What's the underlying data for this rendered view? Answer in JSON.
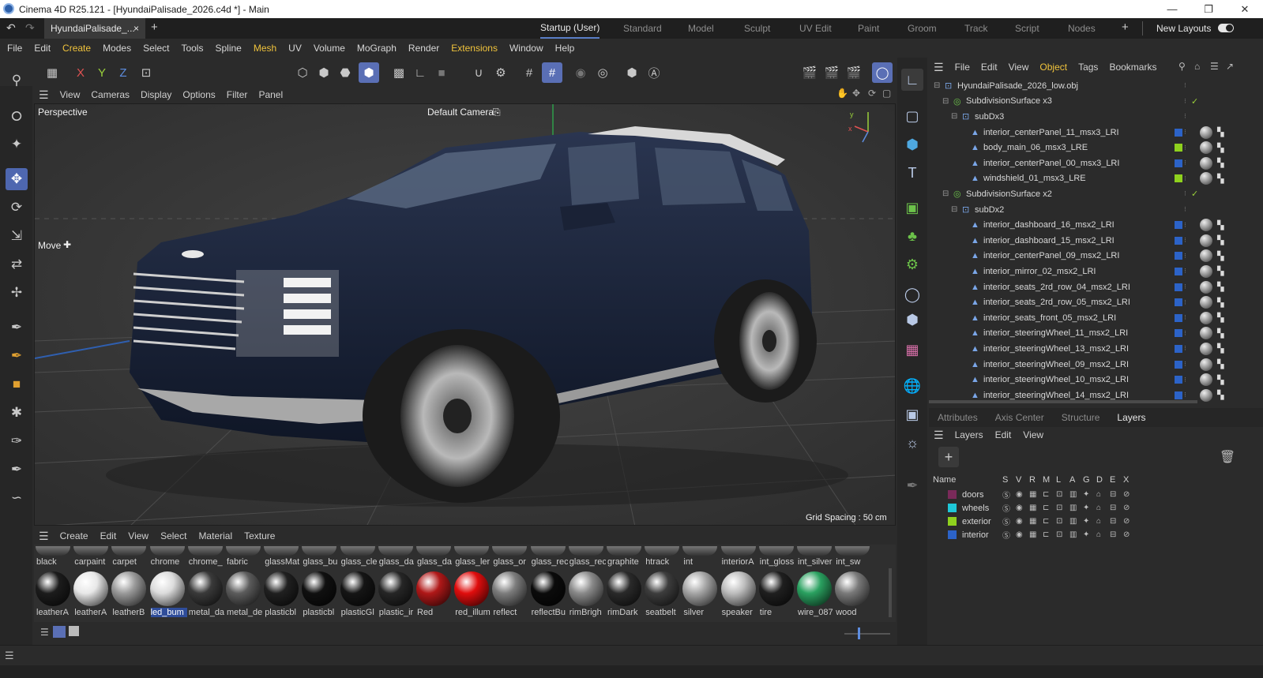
{
  "window": {
    "title": "Cinema 4D R25.121 - [HyundaiPalisade_2026.c4d *] - Main",
    "controls": [
      "minimize-icon",
      "restore-icon",
      "close-icon"
    ]
  },
  "doc_tab": {
    "label": "HyundaiPalisade_...",
    "close": "×",
    "add": "+"
  },
  "layout_tabs": [
    {
      "label": "Startup (User)",
      "active": true
    },
    {
      "label": "Standard",
      "active": false
    },
    {
      "label": "Model",
      "active": false
    },
    {
      "label": "Sculpt",
      "active": false
    },
    {
      "label": "UV Edit",
      "active": false
    },
    {
      "label": "Paint",
      "active": false
    },
    {
      "label": "Groom",
      "active": false
    },
    {
      "label": "Track",
      "active": false
    },
    {
      "label": "Script",
      "active": false
    },
    {
      "label": "Nodes",
      "active": false
    }
  ],
  "new_layouts": "New Layouts",
  "main_menu": [
    "File",
    "Edit",
    "Create",
    "Modes",
    "Select",
    "Tools",
    "Spline",
    "Mesh",
    "UV",
    "Volume",
    "MoGraph",
    "Render",
    "Extensions",
    "Window",
    "Help"
  ],
  "axis_buttons": [
    "X",
    "Y",
    "Z"
  ],
  "viewport": {
    "menu": [
      "View",
      "Cameras",
      "Display",
      "Options",
      "Filter",
      "Panel"
    ],
    "view_name": "Perspective",
    "camera": "Default Camera",
    "tool_label": "Move",
    "grid_spacing": "Grid Spacing : 50 cm"
  },
  "material_menu": [
    "Create",
    "Edit",
    "View",
    "Select",
    "Material",
    "Texture"
  ],
  "materials_row1": [
    "black",
    "carpaint",
    "carpet",
    "chrome",
    "chrome_",
    "fabric",
    "glassMat",
    "glass_bu",
    "glass_cle",
    "glass_da",
    "glass_da",
    "glass_ler",
    "glass_or",
    "glass_rec",
    "glass_rec",
    "graphite",
    "htrack",
    "int",
    "interiorA",
    "int_gloss",
    "int_silver",
    "int_sw"
  ],
  "materials_row2": [
    {
      "name": "leatherA",
      "color": "#1c1c1c"
    },
    {
      "name": "leatherA",
      "color": "#e8e8e8"
    },
    {
      "name": "leatherB",
      "color": "#9a9a9a"
    },
    {
      "name": "led_bum",
      "color": "#dcdcdc",
      "selected": true
    },
    {
      "name": "metal_da",
      "color": "#3a3a3a"
    },
    {
      "name": "metal_de",
      "color": "#5c5c5c"
    },
    {
      "name": "plasticbl",
      "color": "#202020"
    },
    {
      "name": "plasticbl",
      "color": "#101010"
    },
    {
      "name": "plasticGl",
      "color": "#151515"
    },
    {
      "name": "plastic_ir",
      "color": "#262626"
    },
    {
      "name": "Red",
      "color": "#b01818"
    },
    {
      "name": "red_illum",
      "color": "#e00d0d"
    },
    {
      "name": "reflect",
      "color": "#7d7d7d"
    },
    {
      "name": "reflectBu",
      "color": "#0b0b0b"
    },
    {
      "name": "rimBrigh",
      "color": "#8a8a8a"
    },
    {
      "name": "rimDark",
      "color": "#2a2a2a"
    },
    {
      "name": "seatbelt",
      "color": "#3d3d3d"
    },
    {
      "name": "silver",
      "color": "#a6a6a6"
    },
    {
      "name": "speaker",
      "color": "#bdbdbd"
    },
    {
      "name": "tire",
      "color": "#1f1f1f"
    },
    {
      "name": "wire_087",
      "color": "#2aa160"
    },
    {
      "name": "wood",
      "color": "#7a7a7a"
    }
  ],
  "object_manager": {
    "menu": [
      "File",
      "Edit",
      "View",
      "Object",
      "Tags",
      "Bookmarks"
    ],
    "highlight": "Object",
    "items": [
      {
        "name": "HyundaiPalisade_2026_low.obj",
        "depth": 0,
        "type": "null",
        "chip": ""
      },
      {
        "name": "SubdivisionSurface x3",
        "depth": 1,
        "type": "subd",
        "chip": "",
        "check": true
      },
      {
        "name": "subDx3",
        "depth": 2,
        "type": "null",
        "chip": ""
      },
      {
        "name": "interior_centerPanel_11_msx3_LRI",
        "depth": 3,
        "type": "poly",
        "chip": "#2c63c8"
      },
      {
        "name": "body_main_06_msx3_LRE",
        "depth": 3,
        "type": "poly",
        "chip": "#8fd11e"
      },
      {
        "name": "interior_centerPanel_00_msx3_LRI",
        "depth": 3,
        "type": "poly",
        "chip": "#2c63c8"
      },
      {
        "name": "windshield_01_msx3_LRE",
        "depth": 3,
        "type": "poly",
        "chip": "#8fd11e"
      },
      {
        "name": "SubdivisionSurface x2",
        "depth": 1,
        "type": "subd",
        "chip": "",
        "check": true
      },
      {
        "name": "subDx2",
        "depth": 2,
        "type": "null",
        "chip": ""
      },
      {
        "name": "interior_dashboard_16_msx2_LRI",
        "depth": 3,
        "type": "poly",
        "chip": "#2c63c8"
      },
      {
        "name": "interior_dashboard_15_msx2_LRI",
        "depth": 3,
        "type": "poly",
        "chip": "#2c63c8"
      },
      {
        "name": "interior_centerPanel_09_msx2_LRI",
        "depth": 3,
        "type": "poly",
        "chip": "#2c63c8"
      },
      {
        "name": "interior_mirror_02_msx2_LRI",
        "depth": 3,
        "type": "poly",
        "chip": "#2c63c8"
      },
      {
        "name": "interior_seats_2rd_row_04_msx2_LRI",
        "depth": 3,
        "type": "poly",
        "chip": "#2c63c8"
      },
      {
        "name": "interior_seats_2rd_row_05_msx2_LRI",
        "depth": 3,
        "type": "poly",
        "chip": "#2c63c8"
      },
      {
        "name": "interior_seats_front_05_msx2_LRI",
        "depth": 3,
        "type": "poly",
        "chip": "#2c63c8"
      },
      {
        "name": "interior_steeringWheel_11_msx2_LRI",
        "depth": 3,
        "type": "poly",
        "chip": "#2c63c8"
      },
      {
        "name": "interior_steeringWheel_13_msx2_LRI",
        "depth": 3,
        "type": "poly",
        "chip": "#2c63c8"
      },
      {
        "name": "interior_steeringWheel_09_msx2_LRI",
        "depth": 3,
        "type": "poly",
        "chip": "#2c63c8"
      },
      {
        "name": "interior_steeringWheel_10_msx2_LRI",
        "depth": 3,
        "type": "poly",
        "chip": "#2c63c8"
      },
      {
        "name": "interior_steeringWheel_14_msx2_LRI",
        "depth": 3,
        "type": "poly",
        "chip": "#2c63c8"
      }
    ]
  },
  "attr_tabs": [
    {
      "label": "Attributes",
      "active": false
    },
    {
      "label": "Axis Center",
      "active": false
    },
    {
      "label": "Structure",
      "active": false
    },
    {
      "label": "Layers",
      "active": true
    }
  ],
  "layers": {
    "menu": [
      "Layers",
      "Edit",
      "View"
    ],
    "header": {
      "name": "Name",
      "flags": [
        "S",
        "V",
        "R",
        "M",
        "L",
        "A",
        "G",
        "D",
        "E",
        "X"
      ]
    },
    "rows": [
      {
        "name": "doors",
        "color": "#7a2a5a"
      },
      {
        "name": "wheels",
        "color": "#1ec8d8"
      },
      {
        "name": "exterior",
        "color": "#8fd11e"
      },
      {
        "name": "interior",
        "color": "#2c63c8"
      }
    ]
  }
}
